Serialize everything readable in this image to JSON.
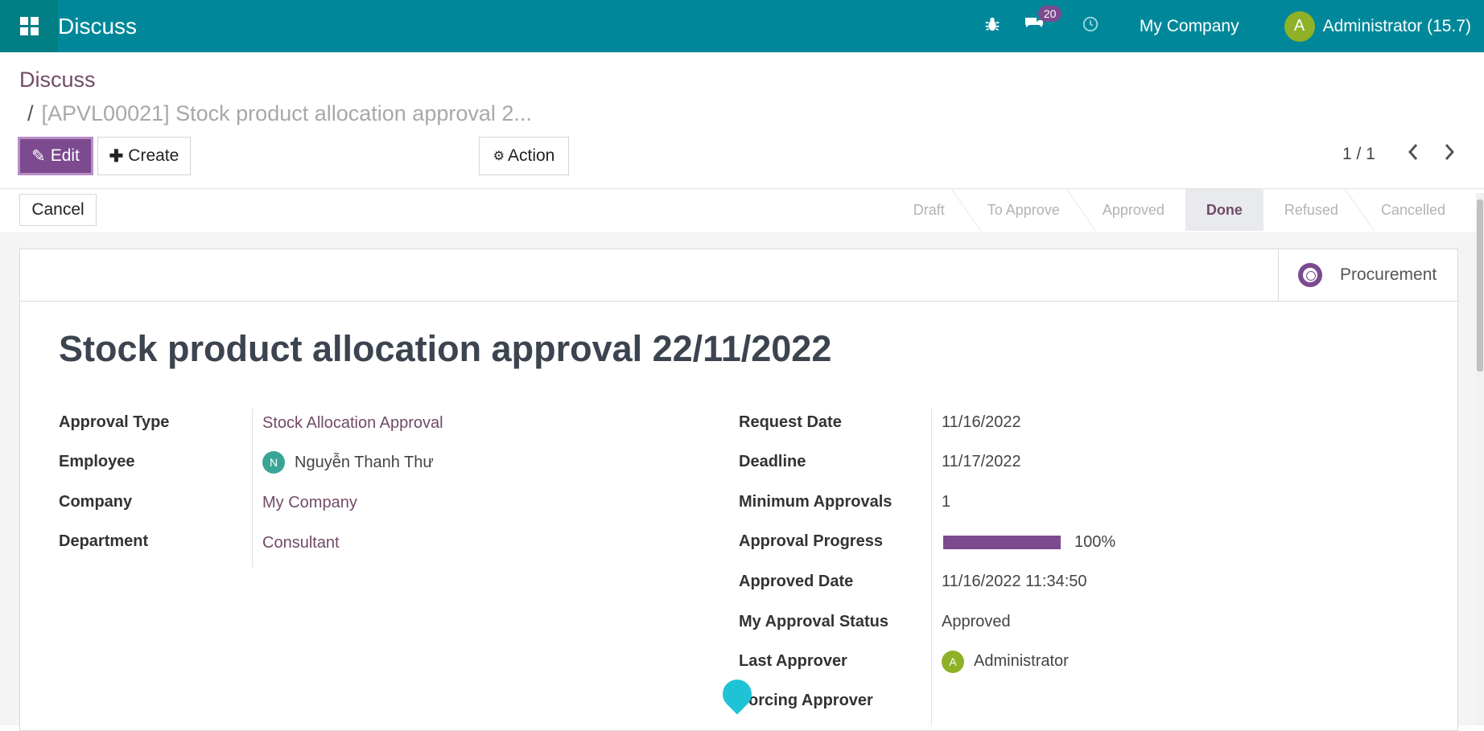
{
  "navbar": {
    "app_title": "Discuss",
    "message_count": "20",
    "company": "My Company",
    "user_initial": "A",
    "user_name": "Administrator (15.7)",
    "accent": "#00889a"
  },
  "breadcrumb": {
    "parent": "Discuss",
    "separator": "/",
    "current": "[APVL00021] Stock product allocation approval 2..."
  },
  "toolbar": {
    "edit_label": "Edit",
    "create_label": "Create",
    "action_label": "Action",
    "pager_value": "1 / 1",
    "prev_icon": "chevron-left-icon",
    "next_icon": "chevron-right-icon"
  },
  "statusbar": {
    "cancel_label": "Cancel",
    "stages": [
      "Draft",
      "To Approve",
      "Approved",
      "Done",
      "Refused",
      "Cancelled"
    ],
    "active_stage": "Done"
  },
  "smart_button": {
    "label": "Procurement",
    "icon": "life-ring-icon"
  },
  "record": {
    "title": "Stock product allocation approval 22/11/2022"
  },
  "left_fields": [
    {
      "label": "Approval Type",
      "value": "Stock Allocation Approval"
    },
    {
      "label": "Employee",
      "value": "Nguyễn Thanh Thư",
      "avatar": "N"
    },
    {
      "label": "Company",
      "value": "My Company"
    },
    {
      "label": "Department",
      "value": "Consultant"
    }
  ],
  "right_fields": [
    {
      "label": "Request Date",
      "value": "11/16/2022"
    },
    {
      "label": "Deadline",
      "value": "11/17/2022"
    },
    {
      "label": "Minimum Approvals",
      "value": "1"
    },
    {
      "label": "Approval Progress",
      "value": "100%"
    },
    {
      "label": "Approved Date",
      "value": "11/16/2022 11:34:50"
    },
    {
      "label": "My Approval Status",
      "value": "Approved"
    },
    {
      "label": "Last Approver",
      "value": "Administrator",
      "avatar": "A"
    },
    {
      "label": "orcing Approver",
      "value": ""
    }
  ],
  "approval_progress_fraction": 1.0,
  "colors": {
    "primary": "#7c4a8f",
    "link": "#714b67",
    "navbar": "#00889a"
  }
}
